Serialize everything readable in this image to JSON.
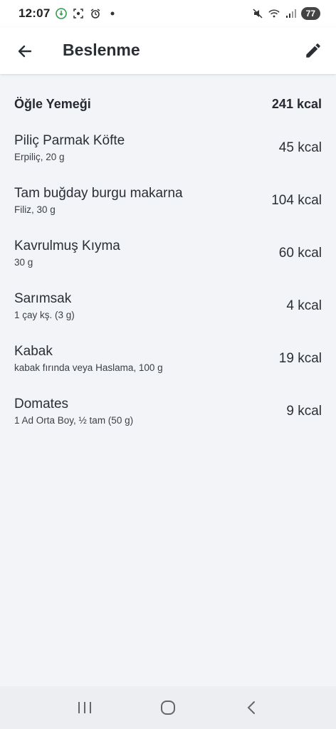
{
  "status_bar": {
    "time": "12:07",
    "battery": "77"
  },
  "app_bar": {
    "title": "Beslenme"
  },
  "meal": {
    "name": "Öğle Yemeği",
    "total": "241 kcal",
    "items": [
      {
        "name": "Piliç Parmak Köfte",
        "detail": "Erpiliç, 20 g",
        "kcal": "45 kcal"
      },
      {
        "name": "Tam buğday burgu makarna",
        "detail": "Filiz, 30 g",
        "kcal": "104 kcal"
      },
      {
        "name": "Kavrulmuş Kıyma",
        "detail": "30 g",
        "kcal": "60 kcal"
      },
      {
        "name": "Sarımsak",
        "detail": "1 çay kş. (3 g)",
        "kcal": "4 kcal"
      },
      {
        "name": "Kabak",
        "detail": "kabak fırında veya Haslama, 100 g",
        "kcal": "19 kcal"
      },
      {
        "name": "Domates",
        "detail": "1 Ad Orta Boy, ½ tam (50 g)",
        "kcal": "9 kcal"
      }
    ]
  }
}
